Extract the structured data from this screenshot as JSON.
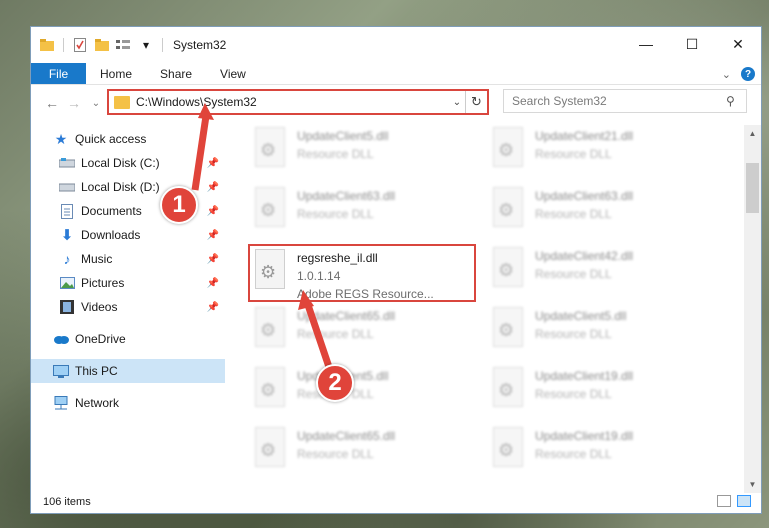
{
  "window": {
    "title": "System32",
    "caption": {
      "minimize": "—",
      "maximize": "☐",
      "close": "✕"
    }
  },
  "ribbon": {
    "file_tab": "File",
    "tabs": [
      "Home",
      "Share",
      "View"
    ]
  },
  "navigation": {
    "back": "←",
    "forward": "→",
    "recent": "⌄",
    "up": "↑",
    "address": "C:\\Windows\\System32",
    "search_placeholder": "Search System32"
  },
  "sidebar": {
    "quick_access": "Quick access",
    "items": [
      {
        "label": "Local Disk (C:)",
        "icon": "drive-icon",
        "pinned": true
      },
      {
        "label": "Local Disk (D:)",
        "icon": "drive-icon",
        "pinned": true
      },
      {
        "label": "Documents",
        "icon": "documents-icon",
        "pinned": true
      },
      {
        "label": "Downloads",
        "icon": "downloads-icon",
        "pinned": true
      },
      {
        "label": "Music",
        "icon": "music-icon",
        "pinned": true
      },
      {
        "label": "Pictures",
        "icon": "pictures-icon",
        "pinned": true
      },
      {
        "label": "Videos",
        "icon": "videos-icon",
        "pinned": true
      }
    ],
    "onedrive": "OneDrive",
    "this_pc": "This PC",
    "network": "Network"
  },
  "files": [
    {
      "name": "UpdateClient5.dll",
      "type": "Resource DLL"
    },
    {
      "name": "UpdateClient21.dll",
      "type": "Resource DLL"
    },
    {
      "name": "UpdateClient63.dll",
      "type": "Resource DLL"
    },
    {
      "name": "UpdateClient63.dll",
      "type": "Resource DLL"
    },
    {
      "name": "regsreshe_il.dll",
      "version": "1.0.1.14",
      "description": "Adobe REGS Resource..."
    },
    {
      "name": "UpdateClient42.dll",
      "type": "Resource DLL"
    },
    {
      "name": "UpdateClient65.dll",
      "type": "Resource DLL"
    },
    {
      "name": "UpdateClient5.dll",
      "type": "Resource DLL"
    },
    {
      "name": "UpdateClient5.dll",
      "type": "Resource DLL"
    },
    {
      "name": "UpdateClient19.dll",
      "type": "Resource DLL"
    },
    {
      "name": "UpdateClient65.dll",
      "type": "Resource DLL"
    },
    {
      "name": "UpdateClient19.dll",
      "type": "Resource DLL"
    }
  ],
  "status": {
    "items_count": "106 items"
  },
  "callouts": [
    "1",
    "2"
  ],
  "colors": {
    "accent": "#1979ca",
    "highlight": "#d9463e",
    "selected": "#cce4f7"
  }
}
